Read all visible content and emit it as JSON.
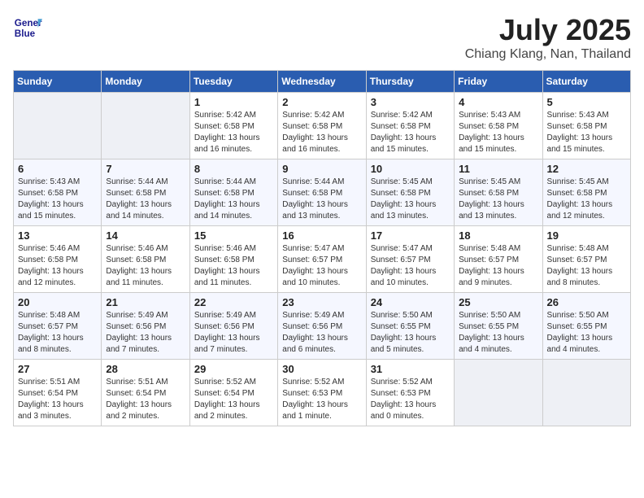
{
  "header": {
    "logo_line1": "General",
    "logo_line2": "Blue",
    "month": "July 2025",
    "location": "Chiang Klang, Nan, Thailand"
  },
  "days_of_week": [
    "Sunday",
    "Monday",
    "Tuesday",
    "Wednesday",
    "Thursday",
    "Friday",
    "Saturday"
  ],
  "weeks": [
    [
      {
        "day": "",
        "info": ""
      },
      {
        "day": "",
        "info": ""
      },
      {
        "day": "1",
        "info": "Sunrise: 5:42 AM\nSunset: 6:58 PM\nDaylight: 13 hours and 16 minutes."
      },
      {
        "day": "2",
        "info": "Sunrise: 5:42 AM\nSunset: 6:58 PM\nDaylight: 13 hours and 16 minutes."
      },
      {
        "day": "3",
        "info": "Sunrise: 5:42 AM\nSunset: 6:58 PM\nDaylight: 13 hours and 15 minutes."
      },
      {
        "day": "4",
        "info": "Sunrise: 5:43 AM\nSunset: 6:58 PM\nDaylight: 13 hours and 15 minutes."
      },
      {
        "day": "5",
        "info": "Sunrise: 5:43 AM\nSunset: 6:58 PM\nDaylight: 13 hours and 15 minutes."
      }
    ],
    [
      {
        "day": "6",
        "info": "Sunrise: 5:43 AM\nSunset: 6:58 PM\nDaylight: 13 hours and 15 minutes."
      },
      {
        "day": "7",
        "info": "Sunrise: 5:44 AM\nSunset: 6:58 PM\nDaylight: 13 hours and 14 minutes."
      },
      {
        "day": "8",
        "info": "Sunrise: 5:44 AM\nSunset: 6:58 PM\nDaylight: 13 hours and 14 minutes."
      },
      {
        "day": "9",
        "info": "Sunrise: 5:44 AM\nSunset: 6:58 PM\nDaylight: 13 hours and 13 minutes."
      },
      {
        "day": "10",
        "info": "Sunrise: 5:45 AM\nSunset: 6:58 PM\nDaylight: 13 hours and 13 minutes."
      },
      {
        "day": "11",
        "info": "Sunrise: 5:45 AM\nSunset: 6:58 PM\nDaylight: 13 hours and 13 minutes."
      },
      {
        "day": "12",
        "info": "Sunrise: 5:45 AM\nSunset: 6:58 PM\nDaylight: 13 hours and 12 minutes."
      }
    ],
    [
      {
        "day": "13",
        "info": "Sunrise: 5:46 AM\nSunset: 6:58 PM\nDaylight: 13 hours and 12 minutes."
      },
      {
        "day": "14",
        "info": "Sunrise: 5:46 AM\nSunset: 6:58 PM\nDaylight: 13 hours and 11 minutes."
      },
      {
        "day": "15",
        "info": "Sunrise: 5:46 AM\nSunset: 6:58 PM\nDaylight: 13 hours and 11 minutes."
      },
      {
        "day": "16",
        "info": "Sunrise: 5:47 AM\nSunset: 6:57 PM\nDaylight: 13 hours and 10 minutes."
      },
      {
        "day": "17",
        "info": "Sunrise: 5:47 AM\nSunset: 6:57 PM\nDaylight: 13 hours and 10 minutes."
      },
      {
        "day": "18",
        "info": "Sunrise: 5:48 AM\nSunset: 6:57 PM\nDaylight: 13 hours and 9 minutes."
      },
      {
        "day": "19",
        "info": "Sunrise: 5:48 AM\nSunset: 6:57 PM\nDaylight: 13 hours and 8 minutes."
      }
    ],
    [
      {
        "day": "20",
        "info": "Sunrise: 5:48 AM\nSunset: 6:57 PM\nDaylight: 13 hours and 8 minutes."
      },
      {
        "day": "21",
        "info": "Sunrise: 5:49 AM\nSunset: 6:56 PM\nDaylight: 13 hours and 7 minutes."
      },
      {
        "day": "22",
        "info": "Sunrise: 5:49 AM\nSunset: 6:56 PM\nDaylight: 13 hours and 7 minutes."
      },
      {
        "day": "23",
        "info": "Sunrise: 5:49 AM\nSunset: 6:56 PM\nDaylight: 13 hours and 6 minutes."
      },
      {
        "day": "24",
        "info": "Sunrise: 5:50 AM\nSunset: 6:55 PM\nDaylight: 13 hours and 5 minutes."
      },
      {
        "day": "25",
        "info": "Sunrise: 5:50 AM\nSunset: 6:55 PM\nDaylight: 13 hours and 4 minutes."
      },
      {
        "day": "26",
        "info": "Sunrise: 5:50 AM\nSunset: 6:55 PM\nDaylight: 13 hours and 4 minutes."
      }
    ],
    [
      {
        "day": "27",
        "info": "Sunrise: 5:51 AM\nSunset: 6:54 PM\nDaylight: 13 hours and 3 minutes."
      },
      {
        "day": "28",
        "info": "Sunrise: 5:51 AM\nSunset: 6:54 PM\nDaylight: 13 hours and 2 minutes."
      },
      {
        "day": "29",
        "info": "Sunrise: 5:52 AM\nSunset: 6:54 PM\nDaylight: 13 hours and 2 minutes."
      },
      {
        "day": "30",
        "info": "Sunrise: 5:52 AM\nSunset: 6:53 PM\nDaylight: 13 hours and 1 minute."
      },
      {
        "day": "31",
        "info": "Sunrise: 5:52 AM\nSunset: 6:53 PM\nDaylight: 13 hours and 0 minutes."
      },
      {
        "day": "",
        "info": ""
      },
      {
        "day": "",
        "info": ""
      }
    ]
  ]
}
